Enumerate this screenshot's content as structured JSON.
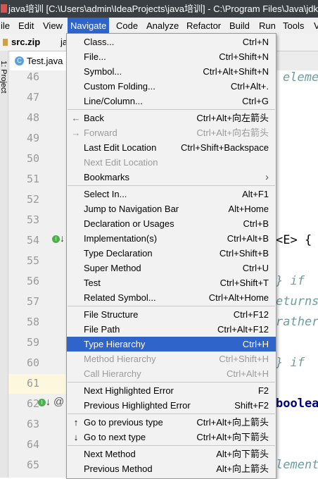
{
  "window": {
    "title": "java培训 [C:\\Users\\admin\\IdeaProjects\\java培训] - C:\\Program Files\\Java\\jdk1"
  },
  "menubar": {
    "items": [
      "ile",
      "Edit",
      "View",
      "Navigate",
      "Code",
      "Analyze",
      "Refactor",
      "Build",
      "Run",
      "Tools",
      "V"
    ]
  },
  "navbar": {
    "path_label": "src.zip",
    "path_next": "ja"
  },
  "editor_tab": {
    "label": "Test.java"
  },
  "sidebar": {
    "project_tab": "1: Project"
  },
  "line_numbers": [
    "46",
    "47",
    "48",
    "49",
    "50",
    "51",
    "52",
    "53",
    "54",
    "55",
    "56",
    "57",
    "58",
    "59",
    "60",
    "61",
    "62",
    "63",
    "64",
    "65"
  ],
  "code_fragments": {
    "l46": "eleme",
    "l54": "<E> {",
    "l56": "} if",
    "l57": "eturns",
    "l58": "rather",
    "l60": "} if",
    "l62": "boolean",
    "l65": "lement"
  },
  "gutter_markers": {
    "l62_at": "@"
  },
  "navigate_menu": {
    "groups": [
      [
        {
          "label": "Class...",
          "shortcut": "Ctrl+N",
          "enabled": true
        },
        {
          "label": "File...",
          "shortcut": "Ctrl+Shift+N",
          "enabled": true
        },
        {
          "label": "Symbol...",
          "shortcut": "Ctrl+Alt+Shift+N",
          "enabled": true
        },
        {
          "label": "Custom Folding...",
          "shortcut": "Ctrl+Alt+.",
          "enabled": true
        },
        {
          "label": "Line/Column...",
          "shortcut": "Ctrl+G",
          "enabled": true
        }
      ],
      [
        {
          "label": "Back",
          "shortcut": "Ctrl+Alt+向左箭头",
          "enabled": true,
          "icon": "←"
        },
        {
          "label": "Forward",
          "shortcut": "Ctrl+Alt+向右箭头",
          "enabled": false,
          "icon": "→"
        },
        {
          "label": "Last Edit Location",
          "shortcut": "Ctrl+Shift+Backspace",
          "enabled": true
        },
        {
          "label": "Next Edit Location",
          "shortcut": "",
          "enabled": false
        },
        {
          "label": "Bookmarks",
          "shortcut": "›",
          "enabled": true
        }
      ],
      [
        {
          "label": "Select In...",
          "shortcut": "Alt+F1",
          "enabled": true
        },
        {
          "label": "Jump to Navigation Bar",
          "shortcut": "Alt+Home",
          "enabled": true
        },
        {
          "label": "Declaration or Usages",
          "shortcut": "Ctrl+B",
          "enabled": true
        },
        {
          "label": "Implementation(s)",
          "shortcut": "Ctrl+Alt+B",
          "enabled": true
        },
        {
          "label": "Type Declaration",
          "shortcut": "Ctrl+Shift+B",
          "enabled": true
        },
        {
          "label": "Super Method",
          "shortcut": "Ctrl+U",
          "enabled": true
        },
        {
          "label": "Test",
          "shortcut": "Ctrl+Shift+T",
          "enabled": true
        },
        {
          "label": "Related Symbol...",
          "shortcut": "Ctrl+Alt+Home",
          "enabled": true
        }
      ],
      [
        {
          "label": "File Structure",
          "shortcut": "Ctrl+F12",
          "enabled": true
        },
        {
          "label": "File Path",
          "shortcut": "Ctrl+Alt+F12",
          "enabled": true
        },
        {
          "label": "Type Hierarchy",
          "shortcut": "Ctrl+H",
          "enabled": true,
          "selected": true
        },
        {
          "label": "Method Hierarchy",
          "shortcut": "Ctrl+Shift+H",
          "enabled": false
        },
        {
          "label": "Call Hierarchy",
          "shortcut": "Ctrl+Alt+H",
          "enabled": false
        }
      ],
      [
        {
          "label": "Next Highlighted Error",
          "shortcut": "F2",
          "enabled": true
        },
        {
          "label": "Previous Highlighted Error",
          "shortcut": "Shift+F2",
          "enabled": true
        }
      ],
      [
        {
          "label": "Go to previous type",
          "shortcut": "Ctrl+Alt+向上箭头",
          "enabled": true,
          "icon": "↑"
        },
        {
          "label": "Go to next type",
          "shortcut": "Ctrl+Alt+向下箭头",
          "enabled": true,
          "icon": "↓"
        }
      ],
      [
        {
          "label": "Next Method",
          "shortcut": "Alt+向下箭头",
          "enabled": true
        },
        {
          "label": "Previous Method",
          "shortcut": "Alt+向上箭头",
          "enabled": true
        }
      ]
    ]
  },
  "colors": {
    "menu_selection": "#2f65ca",
    "title_bar": "#3a3f44",
    "comment": "#6d9e9e",
    "current_line": "#fcf7dd"
  }
}
